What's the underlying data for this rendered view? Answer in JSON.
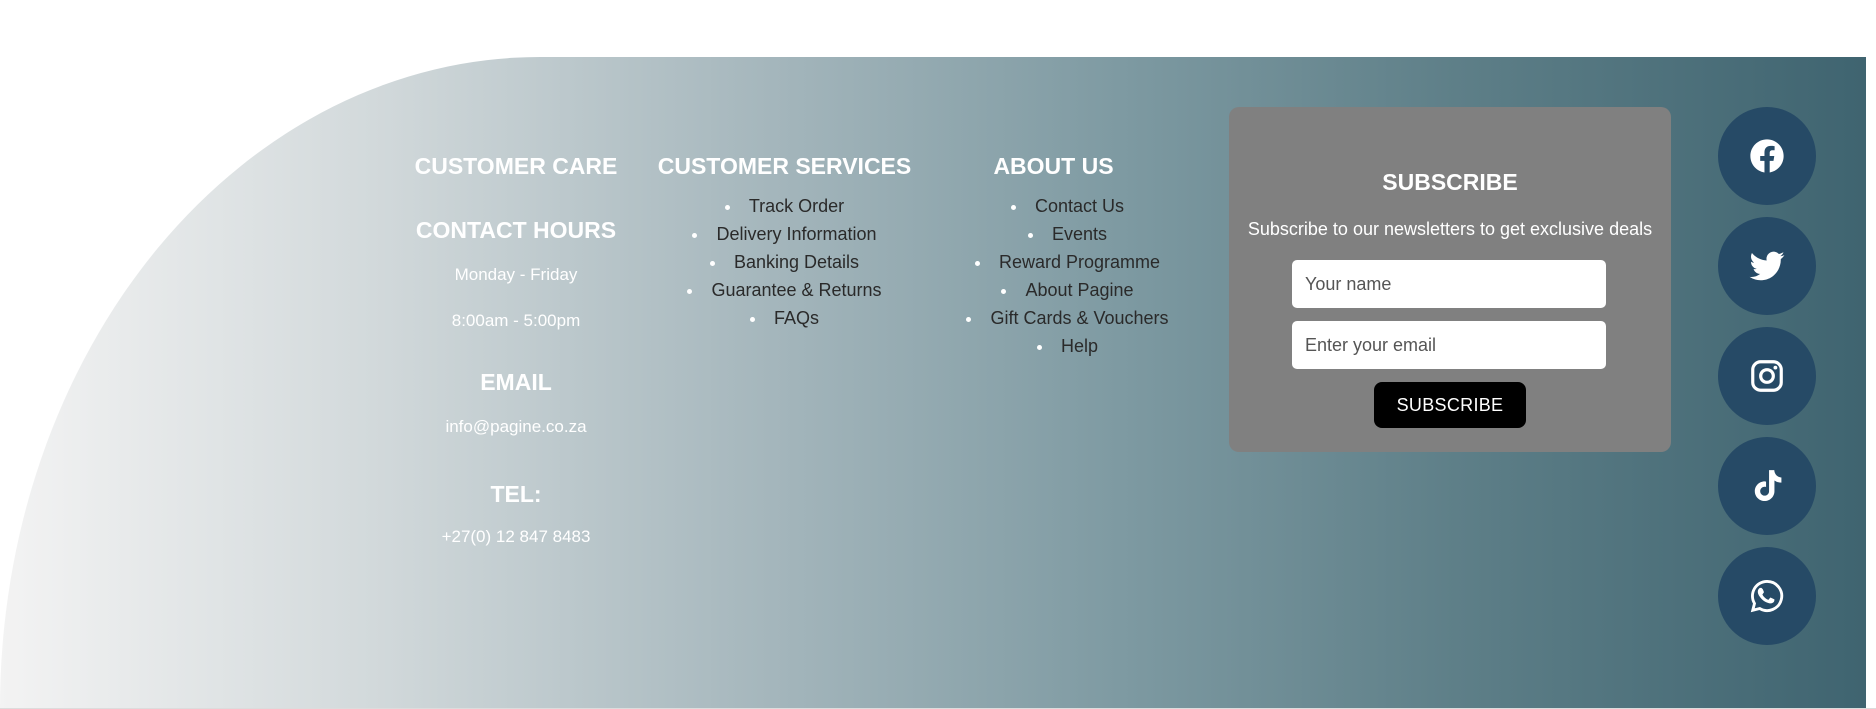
{
  "customer_care": {
    "heading": "CUSTOMER CARE",
    "contact_hours_heading": "CONTACT HOURS",
    "days": "Monday - Friday",
    "hours": "8:00am - 5:00pm",
    "email_heading": "EMAIL",
    "email": "info@pagine.co.za",
    "tel_heading": "TEL:",
    "tel": "+27(0) 12 847 8483"
  },
  "customer_services": {
    "heading": "CUSTOMER SERVICES",
    "links": [
      "Track Order",
      "Delivery Information",
      "Banking Details",
      "Guarantee & Returns",
      "FAQs"
    ]
  },
  "about_us": {
    "heading": "ABOUT US",
    "links": [
      "Contact Us",
      "Events",
      "Reward Programme",
      "About Pagine",
      "Gift Cards & Vouchers",
      "Help"
    ]
  },
  "subscribe": {
    "title": "SUBSCRIBE",
    "text": "Subscribe to our newsletters to get exclusive deals",
    "name_placeholder": "Your name",
    "email_placeholder": "Enter your email",
    "button_label": "SUBSCRIBE"
  },
  "social": {
    "icons": [
      "facebook-icon",
      "twitter-icon",
      "instagram-icon",
      "tiktok-icon",
      "whatsapp-icon"
    ],
    "button_color": "#264a66"
  },
  "colors": {
    "subscribe_box": "#808080",
    "subscribe_button": "#000000",
    "gradient_end": "#3f6470"
  }
}
